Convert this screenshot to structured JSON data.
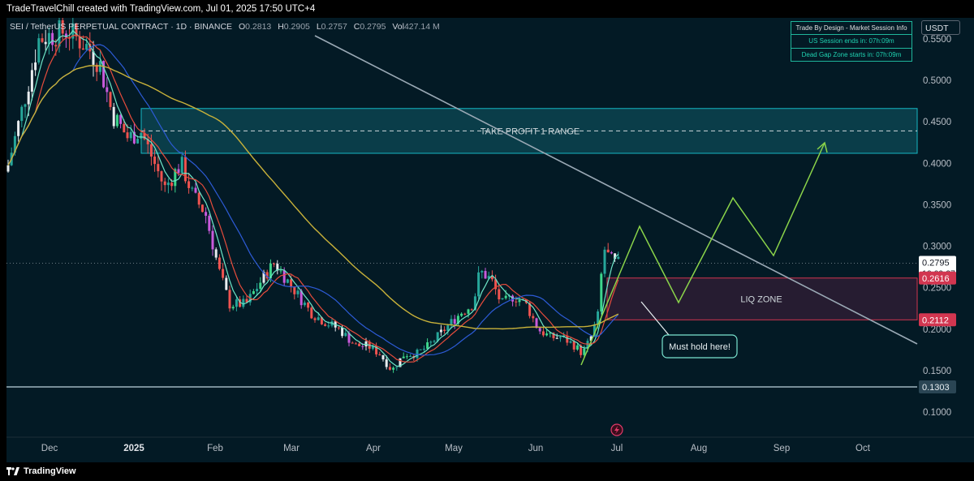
{
  "header": {
    "attribution": "TradeTravelChill created with TradingView.com, Jul 01, 2025 17:50 UTC+4"
  },
  "symbol": {
    "title": "SEI / TetherUS PERPETUAL CONTRACT · 1D · BINANCE",
    "o_label": "O",
    "o": "0.2813",
    "h_label": "H",
    "h": "0.2905",
    "l_label": "L",
    "l": "0.2757",
    "c_label": "C",
    "c": "0.2795",
    "vol_label": "Vol",
    "vol": "427.14 M"
  },
  "session_box": {
    "title": "Trade By Design - Market Session Info",
    "line1": "US Session ends in: 07h:09m",
    "line2": "Dead Gap Zone starts in: 07h:09m"
  },
  "currency": "USDT",
  "footer": {
    "brand": "TradingView"
  },
  "chart_data": {
    "type": "line",
    "y_axis": {
      "ticks": [
        "0.5500",
        "0.5000",
        "0.4500",
        "0.4000",
        "0.3500",
        "0.3000",
        "0.2500",
        "0.2000",
        "0.1500",
        "0.1000"
      ],
      "range": [
        0.08,
        0.57
      ],
      "position": "right"
    },
    "x_axis": {
      "ticks": [
        {
          "label": "Dec",
          "bold": false
        },
        {
          "label": "2025",
          "bold": true
        },
        {
          "label": "Feb",
          "bold": false
        },
        {
          "label": "Mar",
          "bold": false
        },
        {
          "label": "Apr",
          "bold": false
        },
        {
          "label": "May",
          "bold": false
        },
        {
          "label": "Jun",
          "bold": false
        },
        {
          "label": "Jul",
          "bold": false
        },
        {
          "label": "Aug",
          "bold": false
        },
        {
          "label": "Sep",
          "bold": false
        },
        {
          "label": "Oct",
          "bold": false
        }
      ]
    },
    "price_labels": [
      {
        "value": "0.2795",
        "subtext": "10:09:27",
        "style": "current"
      },
      {
        "value": "0.2616",
        "style": "red"
      },
      {
        "value": "0.2112",
        "style": "red"
      },
      {
        "value": "0.1303",
        "style": "support"
      }
    ],
    "current_price": 0.2795,
    "zones": [
      {
        "label": "TAKE PROFIT 1 RANGE",
        "from": 0.412,
        "to": 0.466,
        "mid": 0.439,
        "color": "#16b8c4"
      },
      {
        "label": "LIQ ZONE",
        "from": 0.2112,
        "to": 0.2616,
        "color": "#d23650"
      }
    ],
    "support_level": 0.1303,
    "annotations": [
      {
        "text": "Must hold here!"
      }
    ],
    "colors": {
      "background": "#031a25",
      "up": "#26a69a",
      "down": "#ef5350",
      "ma_fast": "#6ee6c8",
      "ma_red": "#e74c3c",
      "ma_blue": "#2d5bd6",
      "ma_yellow": "#c9b23a",
      "projection": "#8bd44a",
      "trendline": "#9aa9b5"
    },
    "series": [
      {
        "type": "candles",
        "description": "daily SEI/USDT candles, Nov 2024 – Jul 01 2025"
      },
      {
        "type": "ma",
        "color": "fast"
      },
      {
        "type": "ma",
        "color": "red"
      },
      {
        "type": "ma",
        "color": "blue"
      },
      {
        "type": "ma",
        "color": "yellow"
      }
    ]
  }
}
